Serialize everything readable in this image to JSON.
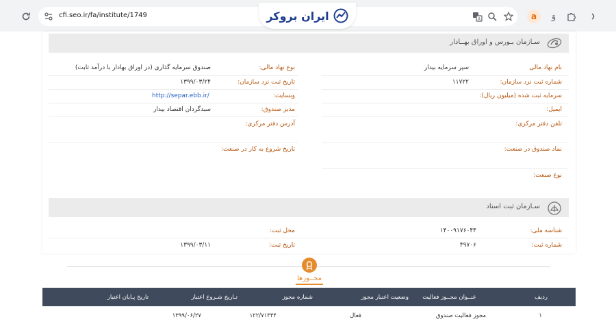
{
  "browser": {
    "url": "cfi.seo.ir/fa/institute/1749",
    "logo_text": "ایران بروکر",
    "extension_letter": "a"
  },
  "sections": {
    "sebo_title": "سـازمان بـورس و اوراق بهــادار",
    "registry_title": "سـازمان ثبت اسناد"
  },
  "institute": {
    "name_label": "نام نهاد مالی",
    "name_value": "سپر سرمایه بیدار",
    "type_label": "نوع نهاد مالی:",
    "type_value": "صندوق سرمایه گذاری (در اوراق بهادار با درآمد ثابت)",
    "reg_no_label": "شماره ثبت نزد سازمان:",
    "reg_no_value": "۱۱۷۲۲",
    "reg_date_label": "تاریخ ثبت نزد سازمان:",
    "reg_date_value": "۱۳۹۹/۰۳/۲۴",
    "capital_label": "سرمایه ثبت شده (میلیون ریال):",
    "website_label": "وبسایت:",
    "website_value": "http://separ.ebb.ir/",
    "email_label": "ایمیل:",
    "manager_label": "مدیر صندوق:",
    "manager_value": "سبدگردان اقتصاد بیدار",
    "phone_label": "تلفن دفتر مرکزی:",
    "address_label": "آدرس دفتر مرکزی:",
    "symbol_label": "نماد صندوق در صنعت:",
    "start_label": "تاریخ شروع به کار در صنعت:",
    "industry_label": "نوع صنعت:"
  },
  "registry": {
    "national_id_label": "شناسه ملی:",
    "national_id_value": "۱۴۰۰۹۱۷۶۰۴۴",
    "location_label": "محل ثبت:",
    "reg_no_label": "شماره ثبت:",
    "reg_no_value": "۴۹۷۰۶",
    "reg_date_label": "تاریخ ثبت:",
    "reg_date_value": "۱۳۹۹/۰۳/۱۱"
  },
  "permits": {
    "title": "مجــوزها",
    "columns": [
      "ردیف",
      "عنــوان مجــوز فعالیت",
      "وضعیت اعتبار مجوز",
      "شماره مجوز",
      "تـاریخ شـروع اعتبار",
      "تاریخ پـایان اعتبار"
    ],
    "rows": [
      [
        "۱",
        "مجوز فعالیت صندوق",
        "فعال",
        "۱۲۲/۷۱۳۴۴",
        "۱۳۹۹/۰۶/۲۷",
        ""
      ]
    ]
  },
  "colors": {
    "label": "#b7560e",
    "accent": "#e58b2b",
    "table_header": "#3f4a5c",
    "link": "#2260c4"
  }
}
